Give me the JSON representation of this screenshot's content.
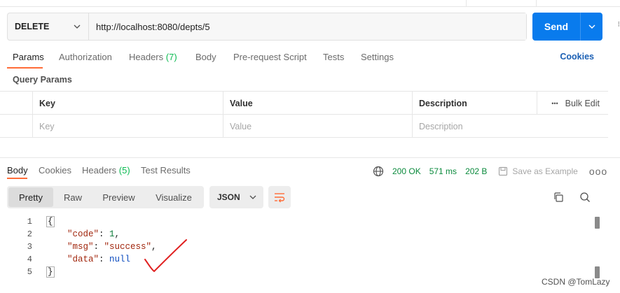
{
  "request": {
    "method": "DELETE",
    "url": "http://localhost:8080/depts/5",
    "send_label": "Send"
  },
  "request_tabs": [
    {
      "label": "Params",
      "count": "",
      "active": true
    },
    {
      "label": "Authorization",
      "count": "",
      "active": false
    },
    {
      "label": "Headers",
      "count": "(7)",
      "active": false
    },
    {
      "label": "Body",
      "count": "",
      "active": false
    },
    {
      "label": "Pre-request Script",
      "count": "",
      "active": false
    },
    {
      "label": "Tests",
      "count": "",
      "active": false
    },
    {
      "label": "Settings",
      "count": "",
      "active": false
    }
  ],
  "cookies_link": "Cookies",
  "query_params": {
    "title": "Query Params",
    "columns": [
      "Key",
      "Value",
      "Description"
    ],
    "placeholders": [
      "Key",
      "Value",
      "Description"
    ],
    "bulk_edit": "Bulk Edit",
    "more": "•••"
  },
  "response_tabs": [
    {
      "label": "Body",
      "count": "",
      "active": true
    },
    {
      "label": "Cookies",
      "count": "",
      "active": false
    },
    {
      "label": "Headers",
      "count": "(5)",
      "active": false
    },
    {
      "label": "Test Results",
      "count": "",
      "active": false
    }
  ],
  "response_status": {
    "status": "200 OK",
    "time": "571 ms",
    "size": "202 B",
    "save_label": "Save as Example",
    "more": "ooo"
  },
  "view_modes": [
    {
      "label": "Pretty",
      "active": true
    },
    {
      "label": "Raw",
      "active": false
    },
    {
      "label": "Preview",
      "active": false
    },
    {
      "label": "Visualize",
      "active": false
    }
  ],
  "format": "JSON",
  "code_lines": [
    {
      "num": "1"
    },
    {
      "num": "2",
      "key": "\"code\"",
      "value": "1",
      "trail": ","
    },
    {
      "num": "3",
      "key": "\"msg\"",
      "value": "\"success\"",
      "trail": ","
    },
    {
      "num": "4",
      "key": "\"data\"",
      "value": "null",
      "trail": ""
    },
    {
      "num": "5"
    }
  ],
  "bracket_open": "{",
  "bracket_close": "}",
  "watermark": "CSDN @TomLazy",
  "edge_glyph": "⁝",
  "colors": {
    "accent": "#ff6c37",
    "send": "#097bed",
    "success": "#0a8a3c"
  }
}
